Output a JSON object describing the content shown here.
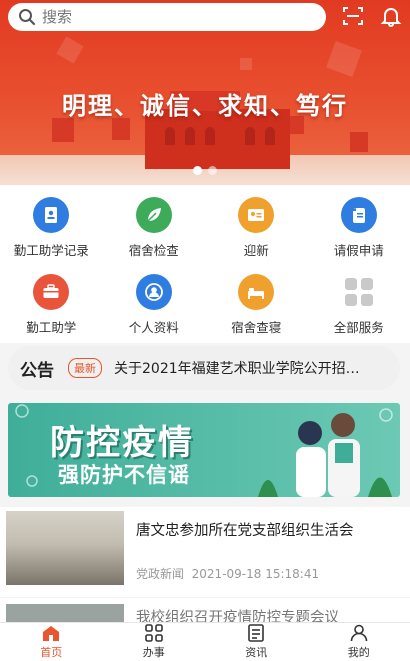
{
  "search": {
    "placeholder": "搜索"
  },
  "hero": {
    "slogan": "明理、诚信、求知、笃行",
    "slide_count": 2,
    "active_slide": 0
  },
  "services": [
    {
      "label": "勤工助学记录",
      "icon": "student-record-icon",
      "color": "#2f7de0"
    },
    {
      "label": "宿舍检查",
      "icon": "leaf-icon",
      "color": "#3dab5a"
    },
    {
      "label": "迎新",
      "icon": "id-card-icon",
      "color": "#f0a02c"
    },
    {
      "label": "请假申请",
      "icon": "scroll-icon",
      "color": "#2f7de0"
    },
    {
      "label": "勤工助学",
      "icon": "toolbox-icon",
      "color": "#e8553a"
    },
    {
      "label": "个人资料",
      "icon": "user-profile-icon",
      "color": "#2f7de0"
    },
    {
      "label": "宿舍查寝",
      "icon": "bed-icon",
      "color": "#f0a02c"
    },
    {
      "label": "全部服务",
      "icon": "grid-apps-icon",
      "color": "#c9c9c9"
    }
  ],
  "notice": {
    "title": "公告",
    "badge": "最新",
    "text": "关于2021年福建艺术职业学院公开招聘…"
  },
  "banner": {
    "title": "防控疫情",
    "subtitle": "强防护不信谣"
  },
  "news": [
    {
      "title": "唐文忠参加所在党支部组织生活会",
      "category": "党政新闻",
      "time": "2021-09-18 15:18:41"
    },
    {
      "title": "我校组织召开疫情防控专题会议"
    }
  ],
  "tabs": [
    {
      "label": "首页",
      "icon": "home-icon",
      "active": true
    },
    {
      "label": "办事",
      "icon": "grid-icon",
      "active": false
    },
    {
      "label": "资讯",
      "icon": "document-icon",
      "active": false
    },
    {
      "label": "我的",
      "icon": "user-icon",
      "active": false
    }
  ],
  "colors": {
    "accent": "#e8552f",
    "hero": "#e23a22",
    "banner": "#3fae99"
  }
}
